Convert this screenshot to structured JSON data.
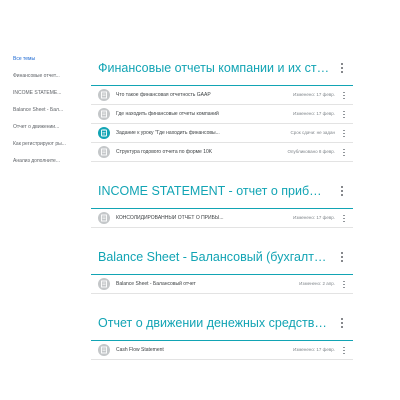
{
  "sidebar": {
    "items": [
      {
        "label": "Все темы"
      },
      {
        "label": "Финансовые отчет..."
      },
      {
        "label": "INCOME STATEME..."
      },
      {
        "label": "Balance Sheet - Бал..."
      },
      {
        "label": "Отчет о движении..."
      },
      {
        "label": "Как регистрируют ры..."
      },
      {
        "label": "Анализ дополните..."
      }
    ]
  },
  "topics": [
    {
      "title": "Финансовые отчеты компании и их структура",
      "items": [
        {
          "title": "Что такое финансовая отчетность GAAP",
          "meta": "Изменено: 17 февр.",
          "icon": "material-icon"
        },
        {
          "title": "Где находить финансовые отчеты компаний",
          "meta": "Изменено: 17 февр.",
          "icon": "material-icon"
        },
        {
          "title": "Задание к уроку \"Где находить финансовы...",
          "meta": "Срок сдачи: не задан",
          "icon": "assignment-icon"
        },
        {
          "title": "Структура годового отчета по форме 10K",
          "meta": "Опубликовано 8 февр.",
          "icon": "material-icon"
        }
      ]
    },
    {
      "title": "INCOME STATEMENT - отчет о прибыли и убытках",
      "items": [
        {
          "title": "КОНСОЛИДИРОВАННЫЙ ОТЧЕТ О ПРИБЫ...",
          "meta": "Изменено: 17 февр.",
          "icon": "material-icon"
        }
      ]
    },
    {
      "title": "Balance Sheet - Балансовый (бухгалтерский) отчет",
      "items": [
        {
          "title": "Balance Sheet - Балансовый отчет",
          "meta": "Изменено: 2 апр.",
          "icon": "material-icon"
        }
      ]
    },
    {
      "title": "Отчет о движении денежных средств Cash Flow Statement",
      "items": [
        {
          "title": "Cash Flow Statement",
          "meta": "Изменено: 17 февр.",
          "icon": "material-icon"
        }
      ]
    }
  ]
}
